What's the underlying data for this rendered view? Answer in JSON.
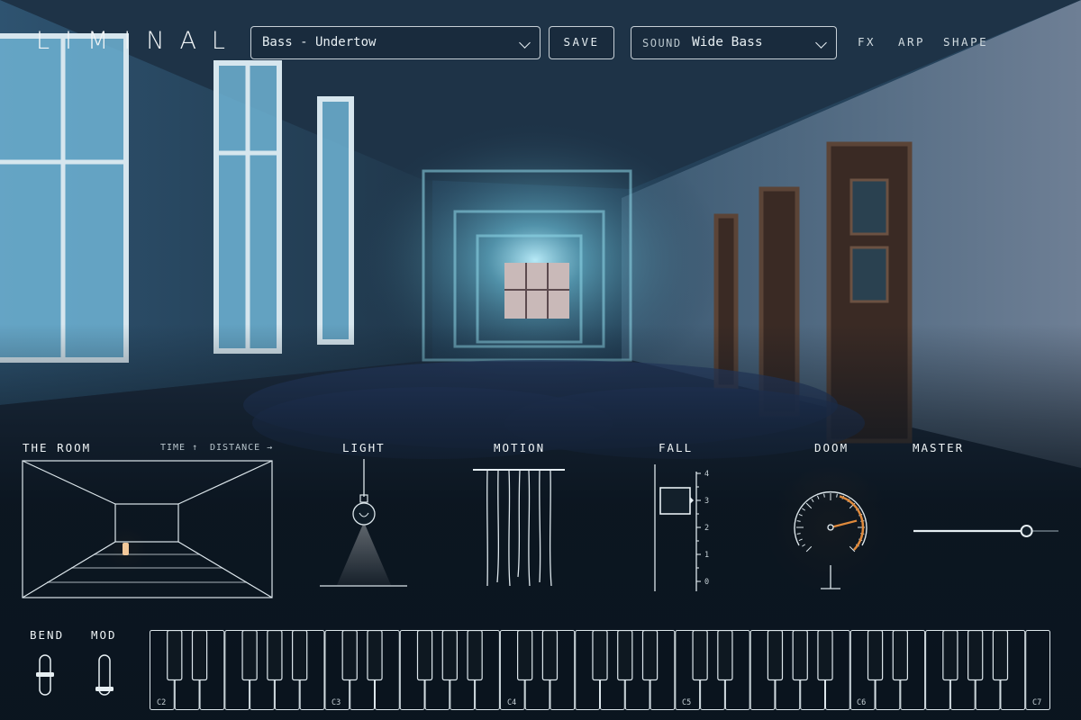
{
  "app": {
    "logo": "LIMINAL"
  },
  "header": {
    "preset": {
      "value": "Bass - Undertow"
    },
    "save_label": "SAVE",
    "sound": {
      "label": "SOUND",
      "value": "Wide Bass"
    },
    "nav": [
      "FX",
      "ARP",
      "SHAPE"
    ]
  },
  "room": {
    "title": "THE ROOM",
    "time_label": "TIME ↑",
    "distance_label": "DISTANCE →"
  },
  "light": {
    "title": "LIGHT"
  },
  "motion": {
    "title": "MOTION"
  },
  "fall": {
    "title": "FALL",
    "scale": [
      "4",
      "3",
      "2",
      "1",
      "0"
    ],
    "value": 3
  },
  "doom": {
    "title": "DOOM",
    "value": 0.78
  },
  "master": {
    "title": "MASTER",
    "value": 0.78
  },
  "bend": {
    "title": "BEND"
  },
  "mod": {
    "title": "MOD"
  },
  "keyboard": {
    "octave_labels": [
      "C2",
      "C3",
      "C4",
      "C5",
      "C6",
      "C7"
    ]
  },
  "colors": {
    "accent": "#e08a3c",
    "line": "#e6eef2",
    "bg": "#0b1620"
  }
}
